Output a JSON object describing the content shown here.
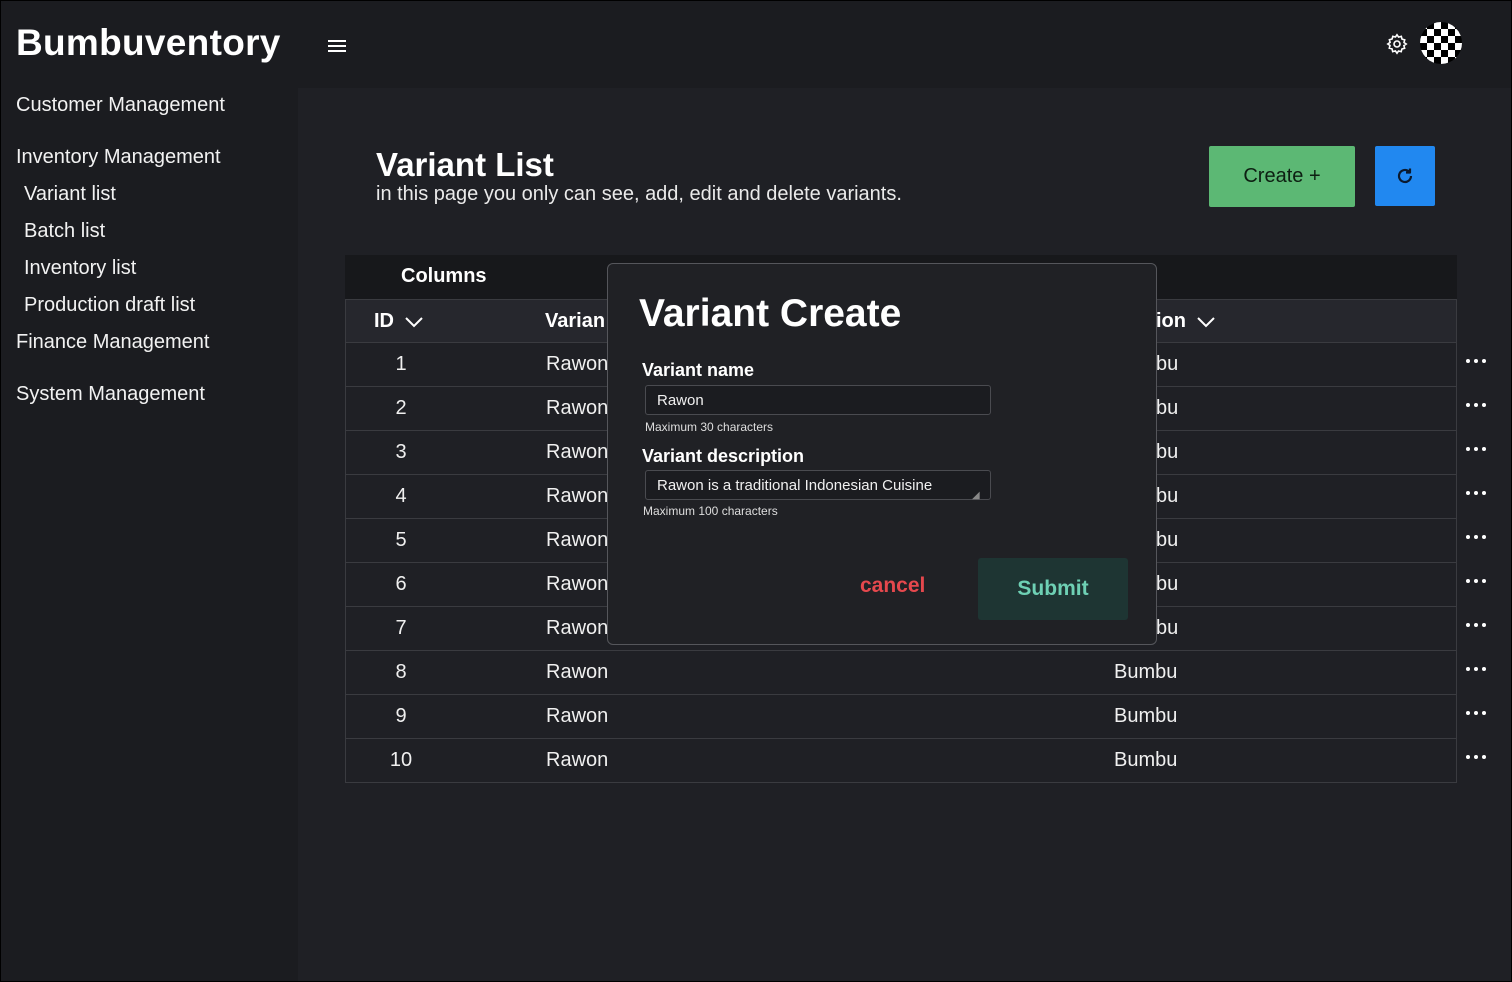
{
  "app": {
    "brand": "Bumbuventory"
  },
  "sidebar": {
    "items": [
      {
        "label": "Customer Management"
      },
      {
        "label": "Inventory Management"
      },
      {
        "label": "Variant list"
      },
      {
        "label": "Batch list"
      },
      {
        "label": "Inventory list"
      },
      {
        "label": "Production draft list"
      },
      {
        "label": "Finance Management"
      },
      {
        "label": "System Management"
      }
    ]
  },
  "topbar": {
    "menu_icon": "hamburger-icon",
    "settings_icon": "gear-icon",
    "avatar": "checkered-avatar"
  },
  "page": {
    "title": "Variant List",
    "subtitle": "in this page you only can see, add, edit and delete variants.",
    "create_label": "Create +",
    "refresh_icon": "refresh-icon"
  },
  "table": {
    "columns_label": "Columns",
    "headers": [
      "ID",
      "Varian",
      "ion"
    ],
    "rows": [
      {
        "id": "1",
        "name": "Rawon",
        "cat": "bu"
      },
      {
        "id": "2",
        "name": "Rawon",
        "cat": "bu"
      },
      {
        "id": "3",
        "name": "Rawon",
        "cat": "bu"
      },
      {
        "id": "4",
        "name": "Rawon",
        "cat": "bu"
      },
      {
        "id": "5",
        "name": "Rawon",
        "cat": "bu"
      },
      {
        "id": "6",
        "name": "Rawon",
        "cat": "bu"
      },
      {
        "id": "7",
        "name": "Rawon",
        "cat": "bu"
      },
      {
        "id": "8",
        "name": "Rawon",
        "cat": "Bumbu"
      },
      {
        "id": "9",
        "name": "Rawon",
        "cat": "Bumbu"
      },
      {
        "id": "10",
        "name": "Rawon",
        "cat": "Bumbu"
      }
    ]
  },
  "modal": {
    "title": "Variant Create",
    "name_label": "Variant name",
    "name_value": "Rawon",
    "name_hint": "Maximum 30 characters",
    "desc_label": "Variant description",
    "desc_value": "Rawon is a traditional Indonesian Cuisine",
    "desc_hint": "Maximum 100 characters",
    "cancel_label": "cancel",
    "submit_label": "Submit"
  },
  "colors": {
    "create_button": "#5cb874",
    "refresh_button": "#2188f0",
    "cancel_text": "#e5484d",
    "submit_text": "#6ed0b4",
    "submit_bg": "#1e3533"
  }
}
